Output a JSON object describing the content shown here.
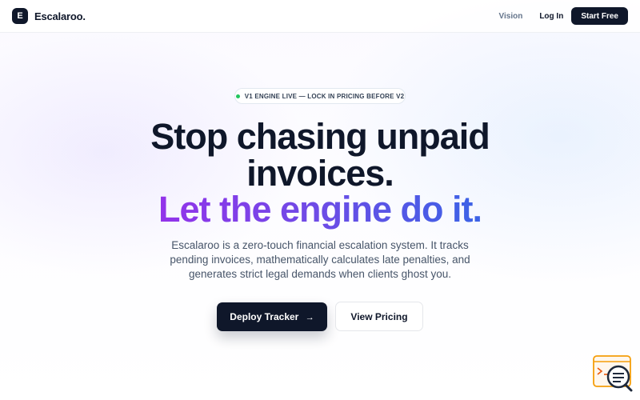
{
  "header": {
    "brand_letter": "E",
    "brand_name": "Escalaroo.",
    "nav": {
      "vision": "Vision",
      "login": "Log In",
      "start_free": "Start Free"
    }
  },
  "hero": {
    "badge": "V1 ENGINE LIVE — LOCK IN PRICING BEFORE V2",
    "headline_line1": "Stop chasing unpaid",
    "headline_line2": "invoices.",
    "headline_accent": "Let the engine do it.",
    "description": "Escalaroo is a zero-touch financial escalation system. It tracks pending invoices, mathematically calculates late penalties, and generates strict legal demands when clients ghost you.",
    "primary_cta": "Deploy Tracker",
    "primary_cta_arrow": "→",
    "secondary_cta": "View Pricing"
  },
  "colors": {
    "primary": "#0f172a",
    "accent_start": "#9333ea",
    "accent_end": "#3b63e6",
    "live_dot": "#22c55e"
  },
  "icons": {
    "floating_widget": "support-chat-icon"
  }
}
